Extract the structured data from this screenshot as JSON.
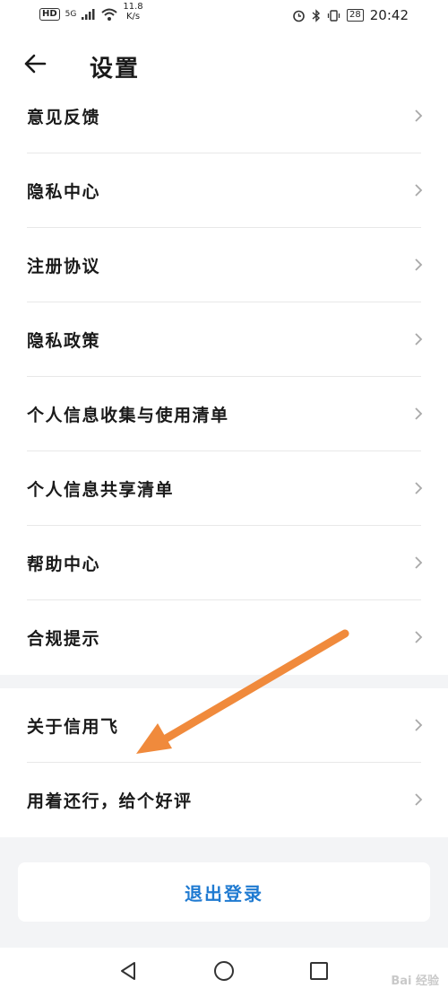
{
  "status_bar": {
    "network_badge": "HD",
    "signal_label": "5G",
    "speed_value": "11.8",
    "speed_unit": "K/s",
    "battery": "28",
    "time": "20:42",
    "icons": [
      "signal-icon",
      "wifi-icon",
      "alarm-icon",
      "bluetooth-icon",
      "vibrate-icon",
      "battery-icon"
    ]
  },
  "header": {
    "title": "设置",
    "back_icon": "arrow-left-icon"
  },
  "settings_group_1": [
    {
      "label": "意见反馈"
    },
    {
      "label": "隐私中心"
    },
    {
      "label": "注册协议"
    },
    {
      "label": "隐私政策"
    },
    {
      "label": "个人信息收集与使用清单"
    },
    {
      "label": "个人信息共享清单"
    },
    {
      "label": "帮助中心"
    },
    {
      "label": "合规提示"
    }
  ],
  "settings_group_2": [
    {
      "label": "关于信用飞"
    },
    {
      "label": "用着还行，给个好评"
    }
  ],
  "logout": {
    "label": "退出登录"
  },
  "nav_bar": {
    "icons": [
      "back-triangle-icon",
      "home-circle-icon",
      "recents-square-icon"
    ]
  },
  "watermark": "Bai 经验",
  "colors": {
    "accent": "#1f7ad1",
    "annotation_arrow": "#f08a3c",
    "background": "#f3f4f6"
  }
}
